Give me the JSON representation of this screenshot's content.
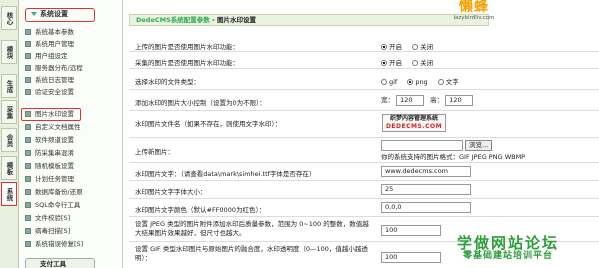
{
  "vtabs": [
    "核心",
    "模块",
    "生成",
    "采集",
    "会员",
    "模板",
    "系统"
  ],
  "menu": {
    "section_title": "系统设置",
    "items": [
      "系统基本参数",
      "系统用户管理",
      "用户组设定",
      "服务器分布/远程",
      "系统日志管理",
      "验证安全设置",
      "图片水印设置",
      "自定义文档属性",
      "软件频道设置",
      "防采集串混淆",
      "随机模板设置",
      "计划任务管理",
      "数据库备份/还原",
      "SQL命令行工具",
      "文件校验[S]",
      "病毒扫描[S]",
      "系统错误修复[S]"
    ],
    "footer_title": "支付工具"
  },
  "header": {
    "title_prefix": "DedeCMS系统配置参数",
    "title_sep": " - ",
    "title_page": "图片水印设置",
    "logo_text": "懒蜂",
    "logo_url": "lazybirdliv.com"
  },
  "rows": [
    {
      "label": "上传的图片是否使用图片水印功能：",
      "opt_on": "开启",
      "opt_off": "关闭"
    },
    {
      "label": "采集的图片是否使用图片水印功能：",
      "opt_on": "开启",
      "opt_off": "关闭"
    },
    {
      "label": "选择水印的文件类型：",
      "opt_gif": "gif",
      "opt_png": "png",
      "opt_text": "文字"
    },
    {
      "label": "添加水印的图片大小控制（设置为0为不限）：",
      "width_label": "宽：",
      "width_value": "120",
      "height_label": "高：",
      "height_value": "120"
    },
    {
      "label": "水印图片文件名（如果不存在，则使用文字水印）：",
      "box_line1": "织梦内容管理系统",
      "box_line2": "DEDECMS.COM"
    },
    {
      "label": "上传新图片：",
      "browse": "浏览...",
      "hint": "你的系统支持的图片格式：GIF JPEG PNG WBMP"
    },
    {
      "label": "水印图片文字：（请查看data\\mark\\simhei.ttf字体是否存在）",
      "value": "www.dedecms.com"
    },
    {
      "label": "水印图片文字字体大小：",
      "value": "25"
    },
    {
      "label": "水印图片文字颜色（默认#FF0000为红色）：",
      "value": "0,0,0"
    },
    {
      "label": "设置 JPEG 类型的图片附件添加水印后质量参数，范围为 0~100 的整数，数值越大结果图片效果越好，但尺寸也越大。",
      "value": "100"
    },
    {
      "label": "设置 GIF 类型水印图片与原始图片的融合度，水印透明度（0—100，值越小越透明）：",
      "value": "100"
    }
  ],
  "watermark": {
    "line1": "学做网站论坛",
    "line2": "零基础建站培训平台"
  }
}
